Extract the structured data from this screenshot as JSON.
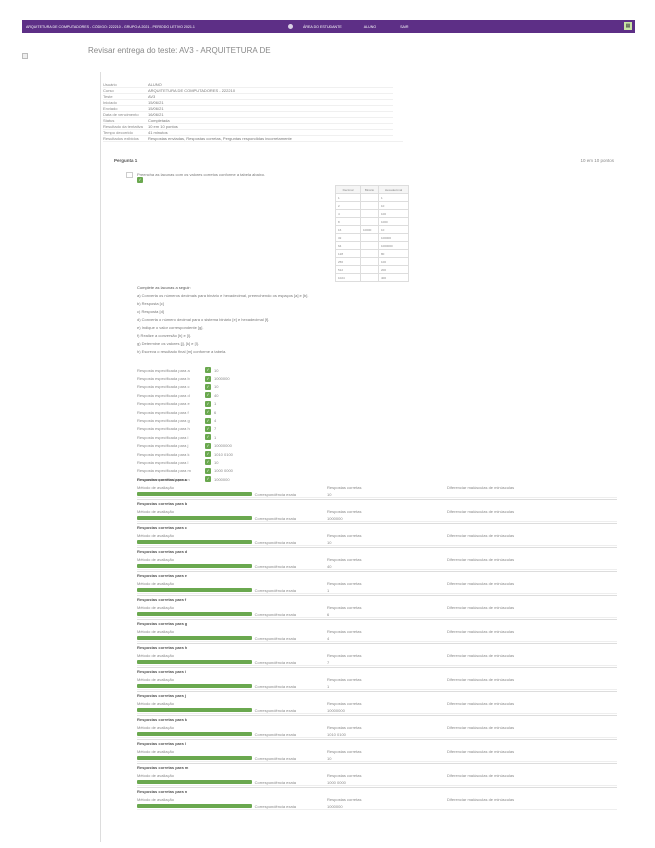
{
  "topbar": {
    "course": "ARQUITETURA DE COMPUTADORES - CÓDIGO: 222210 - GRUPO:A 2021 - PERÍODO LETIVO 2021.1",
    "section": "ÁREA DO ESTUDANTE",
    "user": "ALUNO",
    "logout": "SAIR"
  },
  "page_title": "Revisar entrega do teste: AV3 - ARQUITETURA DE",
  "info": [
    {
      "label": "Usuário",
      "value": "ALUNO"
    },
    {
      "label": "Curso",
      "value": "ARQUITETURA DE COMPUTADORES - 222210"
    },
    {
      "label": "Teste",
      "value": "AV3"
    },
    {
      "label": "Iniciado",
      "value": "15/06/21"
    },
    {
      "label": "Enviado",
      "value": "15/06/21"
    },
    {
      "label": "Data de vencimento",
      "value": "16/06/21"
    },
    {
      "label": "Status",
      "value": "Completada"
    },
    {
      "label": "Resultado da tentativa",
      "value": "10 em 10 pontos"
    },
    {
      "label": "Tempo decorrido",
      "value": "41 minutos"
    },
    {
      "label": "Resultados exibidos",
      "value": "Respostas enviadas, Respostas corretas, Perguntas respondidas incorretamente"
    }
  ],
  "question": {
    "number": "Pergunta 1",
    "points": "10 em 10 pontos",
    "statement": "Preencha as lacunas com os valores corretos conforme a tabela abaixo."
  },
  "mini_table": {
    "headers": [
      "Decimal",
      "Binário",
      "Hexadecimal"
    ],
    "rows": [
      [
        "1",
        "",
        "1"
      ],
      [
        "2",
        "",
        "10"
      ],
      [
        "4",
        "",
        "100"
      ],
      [
        "8",
        "",
        "1000"
      ],
      [
        "16",
        "10000",
        "10"
      ],
      [
        "32",
        "",
        "100000"
      ],
      [
        "64",
        "",
        "1000000"
      ],
      [
        "128",
        "",
        "80"
      ],
      [
        "256",
        "",
        "100"
      ],
      [
        "512",
        "",
        "200"
      ],
      [
        "1024",
        "",
        "400"
      ]
    ]
  },
  "instructions": {
    "title": "Complete as lacunas a seguir:",
    "lines": [
      "a) Converta os números decimais para binário e hexadecimal, preenchendo os espaços [a] e [b].",
      "b) Resposta [c]",
      "c) Resposta [d]",
      "d) Converta o número decimal para o sistema binário [e] e hexadecimal [f].",
      "e) Indique o valor correspondente [g].",
      "f) Realize a conversão [h] e [i].",
      "g) Determine os valores [j], [k] e [l].",
      "h) Escreva o resultado final [m] conforme a tabela."
    ]
  },
  "answers": [
    {
      "label": "Resposta especificada para a",
      "value": "10"
    },
    {
      "label": "Resposta especificada para b",
      "value": "1000000"
    },
    {
      "label": "Resposta especificada para c",
      "value": "10"
    },
    {
      "label": "Resposta especificada para d",
      "value": "40"
    },
    {
      "label": "Resposta especificada para e",
      "value": "1"
    },
    {
      "label": "Resposta especificada para f",
      "value": "6"
    },
    {
      "label": "Resposta especificada para g",
      "value": "4"
    },
    {
      "label": "Resposta especificada para h",
      "value": "7"
    },
    {
      "label": "Resposta especificada para i",
      "value": "1"
    },
    {
      "label": "Resposta especificada para j",
      "value": "10000000"
    },
    {
      "label": "Resposta especificada para k",
      "value": "1010 0100"
    },
    {
      "label": "Resposta especificada para l",
      "value": "10"
    },
    {
      "label": "Resposta especificada para m",
      "value": "1000 0000"
    },
    {
      "label": "Resposta especificada para n",
      "value": "1000000"
    }
  ],
  "responses": {
    "col_eval": "Método de avaliação",
    "col_correct": "Respostas corretas",
    "col_case": "Diferenciar maiúsculas de minúsculas",
    "blocks": [
      {
        "title": "Respostas corretas para a",
        "eval": "Correspondência exata",
        "answer": "10"
      },
      {
        "title": "Respostas corretas para b",
        "eval": "Correspondência exata",
        "answer": "1000000"
      },
      {
        "title": "Respostas corretas para c",
        "eval": "Correspondência exata",
        "answer": "10"
      },
      {
        "title": "Respostas corretas para d",
        "eval": "Correspondência exata",
        "answer": "40"
      },
      {
        "title": "Respostas corretas para e",
        "eval": "Correspondência exata",
        "answer": "1"
      },
      {
        "title": "Respostas corretas para f",
        "eval": "Correspondência exata",
        "answer": "6"
      },
      {
        "title": "Respostas corretas para g",
        "eval": "Correspondência exata",
        "answer": "4"
      },
      {
        "title": "Respostas corretas para h",
        "eval": "Correspondência exata",
        "answer": "7"
      },
      {
        "title": "Respostas corretas para i",
        "eval": "Correspondência exata",
        "answer": "1"
      },
      {
        "title": "Respostas corretas para j",
        "eval": "Correspondência exata",
        "answer": "10000000"
      },
      {
        "title": "Respostas corretas para k",
        "eval": "Correspondência exata",
        "answer": "1010 0100"
      },
      {
        "title": "Respostas corretas para l",
        "eval": "Correspondência exata",
        "answer": "10"
      },
      {
        "title": "Respostas corretas para m",
        "eval": "Correspondência exata",
        "answer": "1000 0000"
      },
      {
        "title": "Respostas corretas para n",
        "eval": "Correspondência exata",
        "answer": "1000000"
      }
    ]
  }
}
